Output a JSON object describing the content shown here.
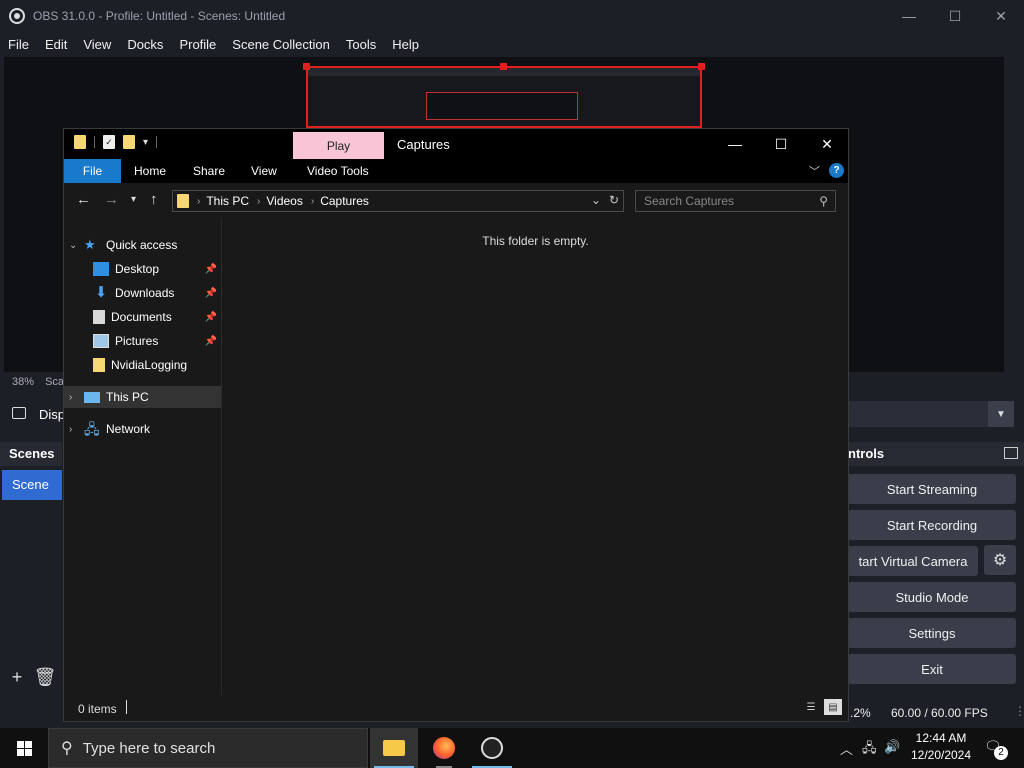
{
  "obs": {
    "title": "OBS 31.0.0 - Profile: Untitled - Scenes: Untitled",
    "menu": [
      "File",
      "Edit",
      "View",
      "Docks",
      "Profile",
      "Scene Collection",
      "Tools",
      "Help"
    ],
    "zoom": "38%",
    "zoom_suffix": "Sca",
    "source_label": "Disp",
    "scenes": {
      "title": "Scenes",
      "items": [
        "Scene"
      ]
    },
    "controls": {
      "title": "ntrols",
      "buttons": [
        "Start Streaming",
        "Start Recording",
        "tart Virtual Camera",
        "Studio Mode",
        "Settings",
        "Exit"
      ]
    },
    "status": {
      "cpu": ".2%",
      "fps": "60.00 / 60.00 FPS"
    }
  },
  "explorer": {
    "qat_context_tab": "Play",
    "title": "Captures",
    "ribbon": {
      "file": "File",
      "home": "Home",
      "share": "Share",
      "view": "View",
      "video_tools": "Video Tools"
    },
    "breadcrumb": [
      "This PC",
      "Videos",
      "Captures"
    ],
    "search_placeholder": "Search Captures",
    "nav": {
      "quick_access": "Quick access",
      "desktop": "Desktop",
      "downloads": "Downloads",
      "documents": "Documents",
      "pictures": "Pictures",
      "nvidia": "NvidiaLogging",
      "this_pc": "This PC",
      "network": "Network"
    },
    "empty_message": "This folder is empty.",
    "status": "0 items"
  },
  "taskbar": {
    "search_placeholder": "Type here to search",
    "time": "12:44 AM",
    "date": "12/20/2024",
    "notification_count": "2"
  },
  "colors": {
    "accent": "#1979ca",
    "selection_red": "#e01f1f",
    "scene_selected": "#2f6bd1",
    "play_tab": "#f9c5d6"
  }
}
